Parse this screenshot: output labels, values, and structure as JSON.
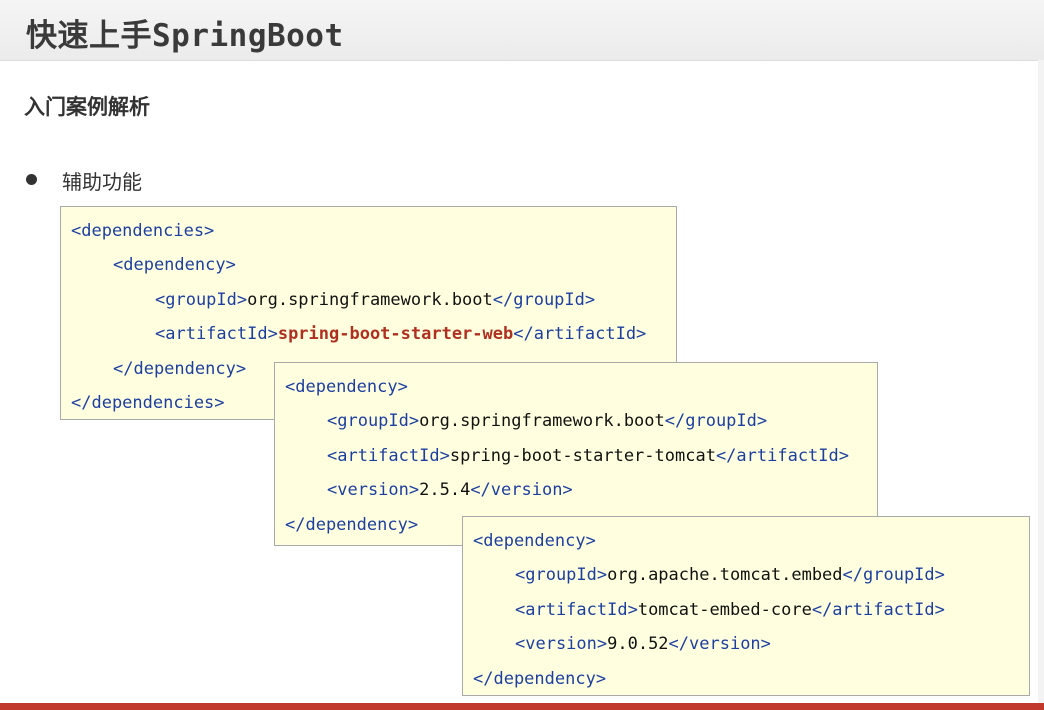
{
  "header": {
    "title": "快速上手SpringBoot"
  },
  "section": {
    "subtitle": "入门案例解析",
    "bullet": "辅助功能"
  },
  "box1": {
    "l1_tag": "<dependencies>",
    "l2_tag": "<dependency>",
    "l3_open": "<groupId>",
    "l3_val": "org.springframework.boot",
    "l3_close": "</groupId>",
    "l4_open": "<artifactId>",
    "l4_val": "spring-boot-starter-web",
    "l4_close": "</artifactId>",
    "l5_tag": "</dependency>",
    "l6_tag": "</dependencies>"
  },
  "box2": {
    "l1_tag": "<dependency>",
    "l2_open": "<groupId>",
    "l2_val": "org.springframework.boot",
    "l2_close": "</groupId>",
    "l3_open": "<artifactId>",
    "l3_val": "spring-boot-starter-tomcat",
    "l3_close": "</artifactId>",
    "l4_open": "<version>",
    "l4_val": "2.5.4",
    "l4_close": "</version>",
    "l5_tag": "</dependency>"
  },
  "box3": {
    "l1_tag": "<dependency>",
    "l2_open": "<groupId>",
    "l2_val": "org.apache.tomcat.embed",
    "l2_close": "</groupId>",
    "l3_open": "<artifactId>",
    "l3_val": "tomcat-embed-core",
    "l3_close": "</artifactId>",
    "l4_open": "<version>",
    "l4_val": "9.0.52",
    "l4_close": "</version>",
    "l5_tag": "</dependency>"
  },
  "colors": {
    "tag": "#1c3fa0",
    "highlight": "#b03020",
    "box_bg": "#ffffe0",
    "bar": "#c0392b"
  }
}
